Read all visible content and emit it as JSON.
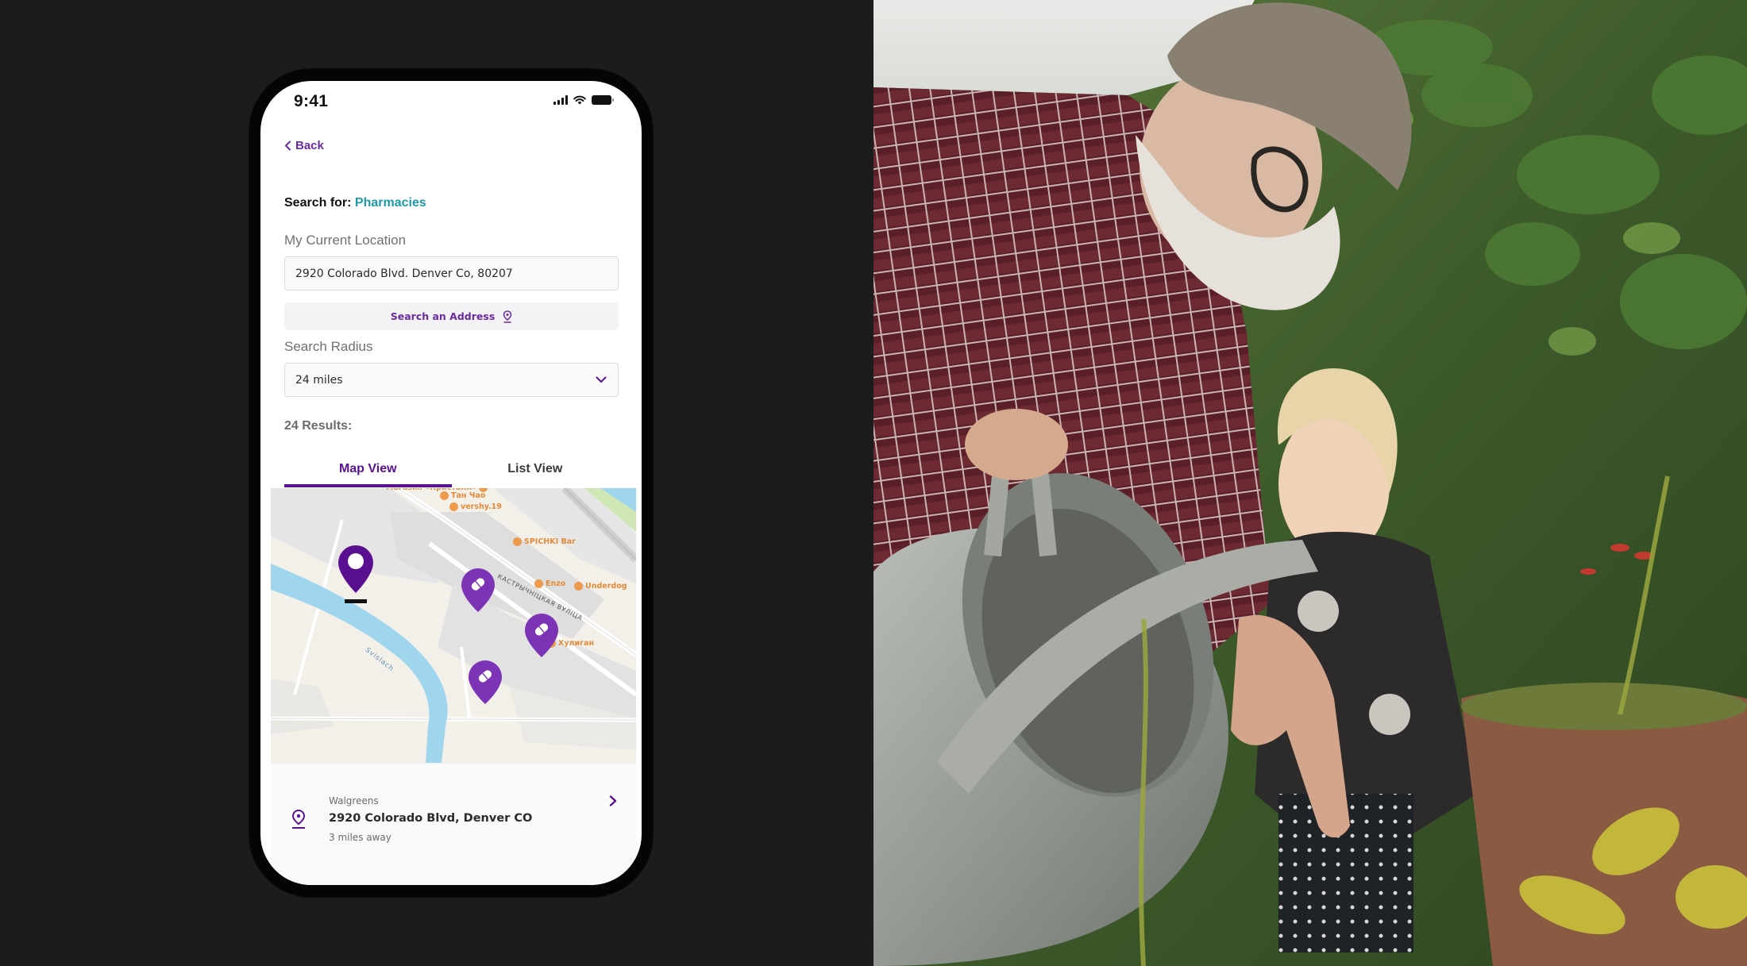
{
  "status_bar": {
    "time": "9:41",
    "icons": [
      "cellular-signal-icon",
      "wifi-icon",
      "battery-icon"
    ]
  },
  "nav": {
    "back_label": "Back"
  },
  "search": {
    "prefix": "Search for:",
    "category": "Pharmacies"
  },
  "location": {
    "label": "My Current Location",
    "value": "2920 Colorado Blvd. Denver Co, 80207",
    "search_address_label": "Search an Address"
  },
  "radius": {
    "label": "Search Radius",
    "selected": "24 miles"
  },
  "results": {
    "count_label": "24 Results:"
  },
  "tabs": [
    {
      "label": "Map View",
      "active": true
    },
    {
      "label": "List View",
      "active": false
    }
  ],
  "map": {
    "pois": [
      "Магазин «Кристалл»",
      "Тан Чао",
      "vershy.19",
      "SPICHKI Bar",
      "Enzo",
      "Underdog",
      "Хулиган"
    ],
    "street_label": "КАСТРЫЧНІЦКАЯ ВУЛІЦА",
    "river_label": "Svislach",
    "markers": [
      {
        "type": "current-location"
      },
      {
        "type": "pharmacy"
      },
      {
        "type": "pharmacy"
      },
      {
        "type": "pharmacy"
      }
    ]
  },
  "result_card": {
    "name": "Walgreens",
    "address": "2920 Colorado Blvd, Denver CO",
    "distance": "3 miles away"
  },
  "colors": {
    "brand_purple": "#5a1192",
    "link_purple": "#6a2aa0",
    "pin_purple": "#7c33b5",
    "accent_teal": "#1a9aa8",
    "poi_orange": "#e48a36",
    "background_dark": "#1c1c1d"
  }
}
